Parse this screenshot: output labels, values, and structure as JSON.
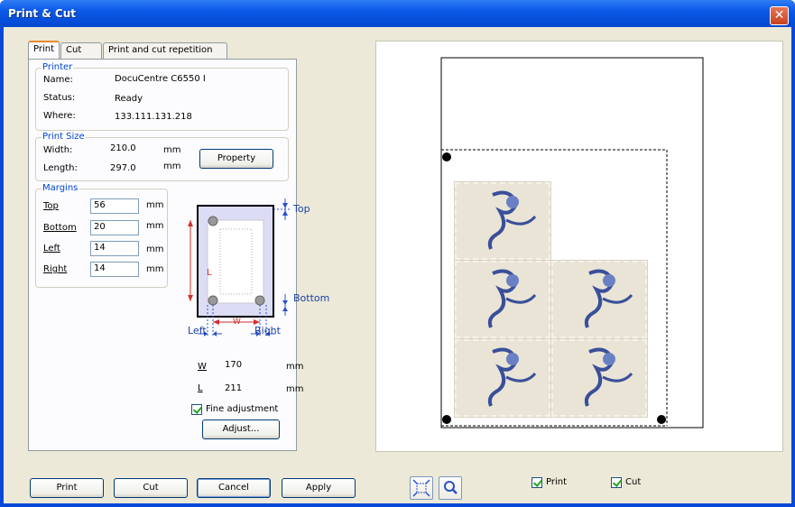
{
  "window": {
    "title": "Print & Cut",
    "close_glyph": "✕"
  },
  "tabs": [
    "Print",
    "Cut",
    "Print and cut repetition"
  ],
  "printer": {
    "group_title": "Printer",
    "name_label": "Name:",
    "name_value": "DocuCentre C6550 I",
    "status_label": "Status:",
    "status_value": "Ready",
    "where_label": "Where:",
    "where_value": "133.111.131.218"
  },
  "print_size": {
    "group_title": "Print Size",
    "width_label": "Width:",
    "width_value": "210.0",
    "width_unit": "mm",
    "length_label": "Length:",
    "length_value": "297.0",
    "length_unit": "mm",
    "property_button": "Property"
  },
  "margins": {
    "group_title": "Margins",
    "top_label": "Top",
    "top_value": "56",
    "top_unit": "mm",
    "bottom_label": "Bottom",
    "bottom_value": "20",
    "bottom_unit": "mm",
    "left_label": "Left",
    "left_value": "14",
    "left_unit": "mm",
    "right_label": "Right",
    "right_value": "14",
    "right_unit": "mm"
  },
  "diagram": {
    "top": "Top",
    "bottom": "Bottom",
    "left": "Left",
    "right": "Right",
    "w": "W",
    "l": "L"
  },
  "computed": {
    "w_label": "W",
    "w_value": "170",
    "w_unit": "mm",
    "l_label": "L",
    "l_value": "211",
    "l_unit": "mm"
  },
  "fine_adjustment": {
    "label": "Fine adjustment",
    "checked": true
  },
  "adjust_button": "Adjust...",
  "bottom_buttons": {
    "print": "Print",
    "cut": "Cut",
    "cancel": "Cancel",
    "apply": "Apply"
  },
  "preview_toolbar": {
    "fit_icon": "fit-page-icon",
    "zoom_icon": "magnifier-icon",
    "print_check_label": "Print",
    "cut_check_label": "Cut"
  },
  "colors": {
    "title_bar": "#0548d1",
    "accent_label": "#0046d5",
    "dialog_bg": "#ece9d8"
  }
}
